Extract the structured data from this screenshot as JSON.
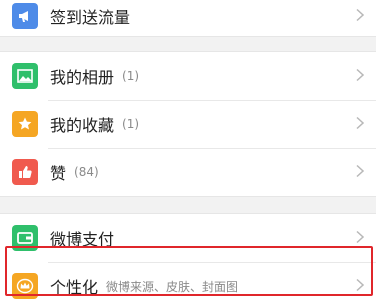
{
  "colors": {
    "checkin_icon": "#4e8be8",
    "album_icon": "#2fbf6b",
    "favorites_icon": "#f5a623",
    "likes_icon": "#f05a4e",
    "pay_icon": "#2fbf6b",
    "personalize_icon": "#f5a623",
    "highlight_border": "#e0262b"
  },
  "menu": {
    "checkin": {
      "label": "签到送流量",
      "icon": "megaphone-icon"
    },
    "album": {
      "label": "我的相册",
      "count": "(1)",
      "icon": "image-icon"
    },
    "favorites": {
      "label": "我的收藏",
      "count": "(1)",
      "icon": "star-icon"
    },
    "likes": {
      "label": "赞",
      "count": "(84)",
      "icon": "thumbs-up-icon"
    },
    "pay": {
      "label": "微博支付",
      "icon": "wallet-icon"
    },
    "personalize": {
      "label": "个性化",
      "subtitle": "微博来源、皮肤、封面图",
      "icon": "crown-icon"
    }
  }
}
